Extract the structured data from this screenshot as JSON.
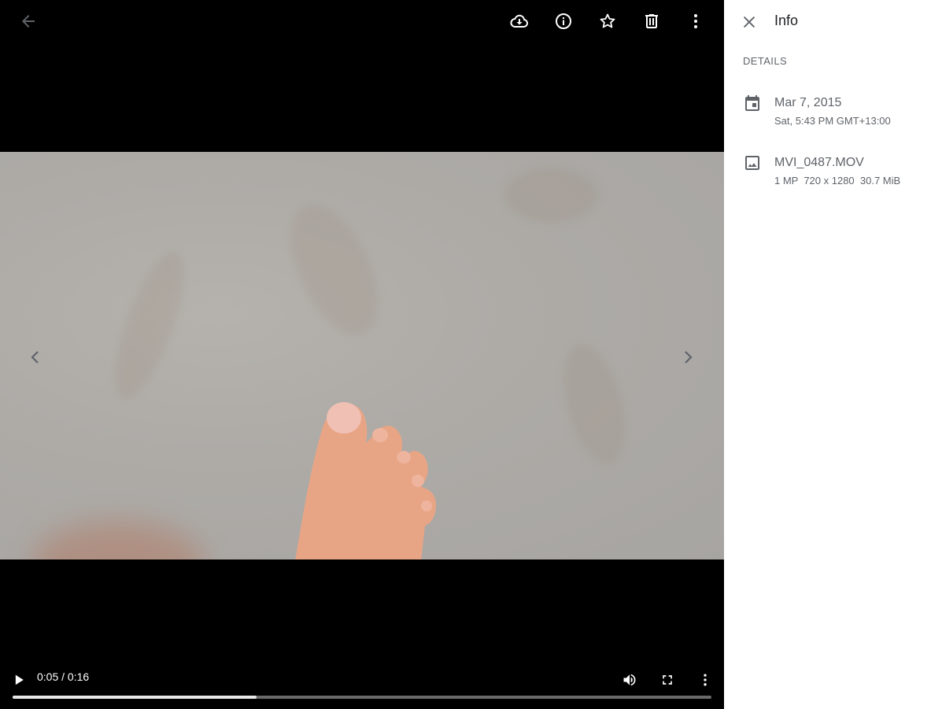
{
  "toolbar": {
    "back_icon": "arrow-back-icon",
    "download_icon": "cloud-download-icon",
    "info_icon": "info-icon",
    "favorite_icon": "star-icon",
    "delete_icon": "trash-icon",
    "more_icon": "more-vert-icon"
  },
  "player": {
    "time_display": "0:05 / 0:16",
    "progress_fraction": 0.349,
    "play_icon": "play-icon",
    "volume_icon": "volume-icon",
    "fullscreen_icon": "fullscreen-icon",
    "more_icon": "more-vert-icon"
  },
  "navigation": {
    "prev_icon": "chevron-left-icon",
    "next_icon": "chevron-right-icon"
  },
  "info_panel": {
    "title": "Info",
    "section": "DETAILS",
    "date": {
      "icon": "calendar-icon",
      "primary": "Mar 7, 2015",
      "secondary": "Sat, 5:43 PM GMT+13:00"
    },
    "file": {
      "icon": "image-icon",
      "primary": "MVI_0487.MOV",
      "secondary": "1 MP  720 x 1280  30.7 MiB"
    }
  },
  "colors": {
    "viewer_bg": "#000000",
    "icon_white": "#ffffff",
    "icon_dim": "#5f6368",
    "panel_text": "#5f6368",
    "panel_title": "#202124"
  }
}
